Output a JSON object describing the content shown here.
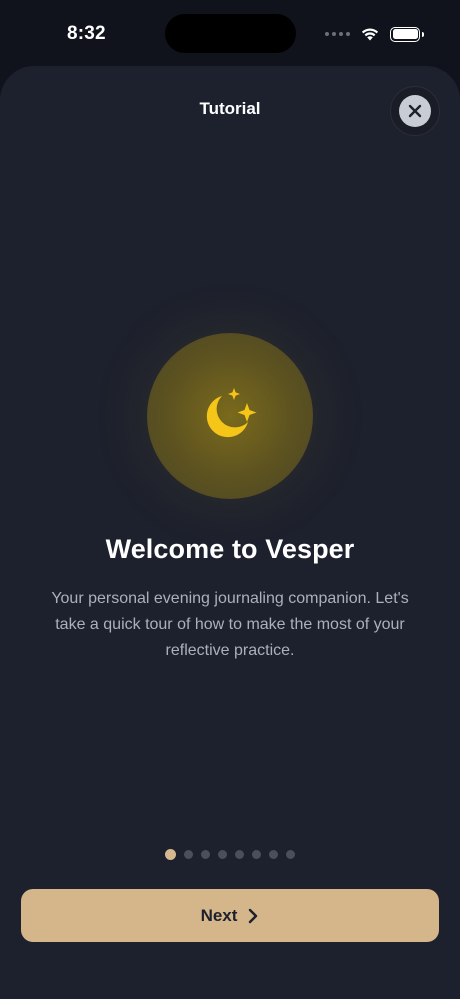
{
  "status_bar": {
    "time": "8:32"
  },
  "sheet": {
    "title": "Tutorial",
    "close_icon": "close-icon"
  },
  "onboarding": {
    "hero_icon": "moon-stars-icon",
    "heading": "Welcome to Vesper",
    "subtitle": "Your personal evening journaling companion. Let's take a quick tour of how to make the most of your reflective practice.",
    "current_page": 1,
    "total_pages": 8
  },
  "footer": {
    "next_label": "Next",
    "next_icon": "chevron-right-icon"
  },
  "colors": {
    "background": "#1d212d",
    "accent": "#d4b68a",
    "moon": "#f5c518"
  }
}
